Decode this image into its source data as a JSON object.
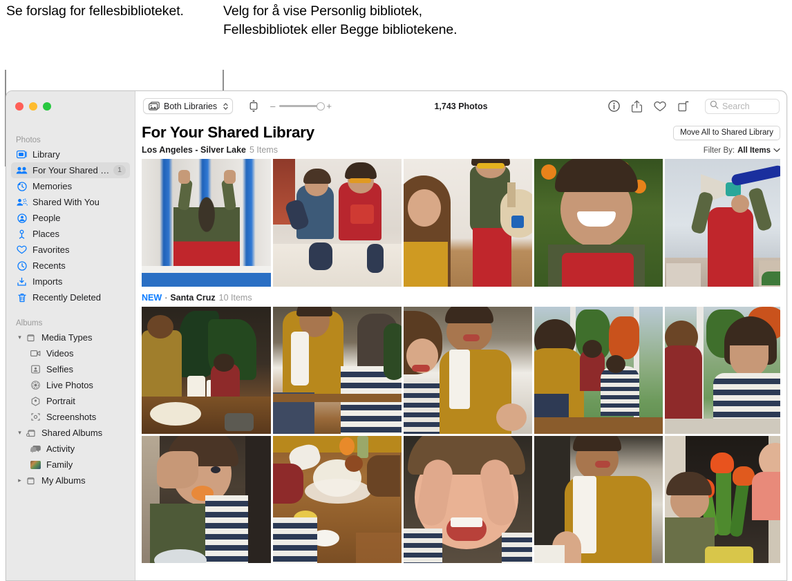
{
  "annotations": [
    {
      "id": "callout-1",
      "text": "Se forslag for fellesbiblioteket."
    },
    {
      "id": "callout-2",
      "text": "Velg for å vise Personlig bibliotek, Fellesbibliotek eller Begge bibliotekene."
    }
  ],
  "window": {
    "traffic_lights": [
      "close",
      "minimize",
      "zoom"
    ]
  },
  "sidebar": {
    "sections": [
      {
        "title": "Photos",
        "items": [
          {
            "label": "Library",
            "icon": "library-icon",
            "selected": false,
            "badge": ""
          },
          {
            "label": "For Your Shared Library",
            "icon": "shared-library-icon",
            "selected": true,
            "badge": "1"
          },
          {
            "label": "Memories",
            "icon": "memories-icon",
            "selected": false,
            "badge": ""
          },
          {
            "label": "Shared With You",
            "icon": "shared-with-you-icon",
            "selected": false,
            "badge": ""
          },
          {
            "label": "People",
            "icon": "people-icon",
            "selected": false,
            "badge": ""
          },
          {
            "label": "Places",
            "icon": "places-icon",
            "selected": false,
            "badge": ""
          },
          {
            "label": "Favorites",
            "icon": "heart-icon",
            "selected": false,
            "badge": ""
          },
          {
            "label": "Recents",
            "icon": "clock-icon",
            "selected": false,
            "badge": ""
          },
          {
            "label": "Imports",
            "icon": "import-icon",
            "selected": false,
            "badge": ""
          },
          {
            "label": "Recently Deleted",
            "icon": "trash-icon",
            "selected": false,
            "badge": ""
          }
        ]
      },
      {
        "title": "Albums",
        "items": [
          {
            "label": "Media Types",
            "icon": "album-icon",
            "disclosure": "open"
          },
          {
            "label": "Videos",
            "icon": "video-icon",
            "indent": true
          },
          {
            "label": "Selfies",
            "icon": "selfie-icon",
            "indent": true
          },
          {
            "label": "Live Photos",
            "icon": "live-photo-icon",
            "indent": true
          },
          {
            "label": "Portrait",
            "icon": "portrait-icon",
            "indent": true
          },
          {
            "label": "Screenshots",
            "icon": "screenshot-icon",
            "indent": true
          },
          {
            "label": "Shared Albums",
            "icon": "shared-album-icon",
            "disclosure": "open"
          },
          {
            "label": "Activity",
            "icon": "activity-icon",
            "indent": true
          },
          {
            "label": "Family",
            "icon": "album-thumbnail-icon",
            "indent": true
          },
          {
            "label": "My Albums",
            "icon": "album-icon",
            "disclosure": "closed"
          }
        ]
      }
    ]
  },
  "toolbar": {
    "library_popup_label": "Both Libraries",
    "library_popup_icon": "libraries-icon",
    "aspect_icon": "aspect-ratio-icon",
    "zoom_out_label": "–",
    "zoom_in_label": "+",
    "photo_count": "1,743 Photos",
    "icons": [
      "info-icon",
      "share-icon",
      "favorite-icon",
      "rotate-icon"
    ],
    "search": {
      "placeholder": "Search",
      "value": "",
      "icon": "search-icon"
    }
  },
  "content": {
    "title": "For Your Shared Library",
    "move_all_button": "Move All to Shared Library",
    "filter_prefix": "Filter By:",
    "filter_value": "All Items",
    "sections": [
      {
        "new_badge": "",
        "label": "Los Angeles - Silver Lake",
        "count": "5 Items",
        "rows": [
          [
            "photo-window-kid",
            "photo-two-boys-bed",
            "photo-guitar-kid",
            "photo-smiling-kid-outdoor",
            "photo-megaphone-kid"
          ]
        ]
      },
      {
        "new_badge": "NEW",
        "separator": "·",
        "label": "Santa Cruz",
        "count": "10 Items",
        "rows": [
          [
            "photo-kitchen-prep",
            "photo-mom-child-baking",
            "photo-mom-laughing",
            "photo-window-kids",
            "photo-kids-striped"
          ],
          [
            "photo-kid-eating",
            "photo-flour-table",
            "photo-floury-face",
            "photo-mom-towel",
            "photo-tulips-kids"
          ]
        ]
      }
    ]
  },
  "colors": {
    "accent": "#0a7cff",
    "sidebar_bg": "#e9e9e9",
    "selected_bg": "#dcdcdc",
    "traffic_red": "#ff5f57",
    "traffic_yellow": "#febc2e",
    "traffic_green": "#28c840"
  }
}
